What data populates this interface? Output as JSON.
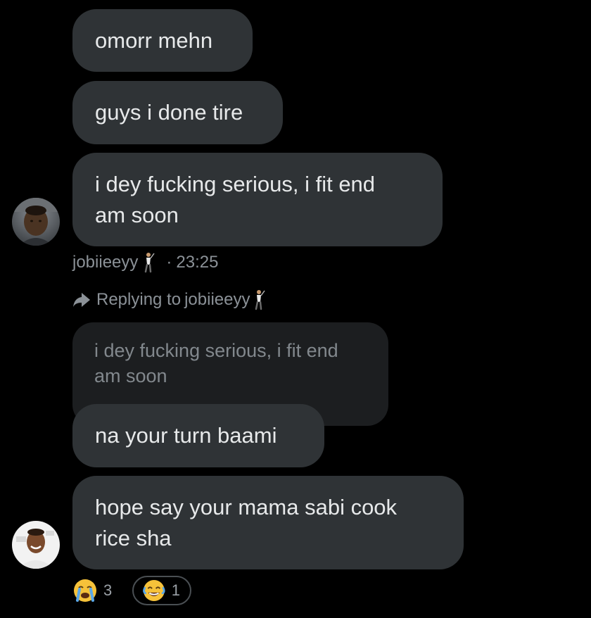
{
  "messages": [
    {
      "text": "omorr mehn"
    },
    {
      "text": "guys i done tire"
    },
    {
      "text": "i dey fucking serious, i fit end\nam soon"
    }
  ],
  "first_sender": {
    "username": "jobiieeyy",
    "timestamp": "23:25",
    "separator": "·",
    "emoji_icon": "golfer-icon"
  },
  "reply": {
    "prefix": "Replying to",
    "username": "jobiieeyy",
    "quoted_text": "i dey fucking serious, i fit end\nam soon",
    "message": "na your turn baami"
  },
  "last_message": {
    "text": "hope say your mama sabi cook\nrice sha"
  },
  "reactions": [
    {
      "emoji": "loudly-crying-face-icon",
      "count": "3"
    },
    {
      "emoji": "face-with-tears-of-joy-icon",
      "count": "1"
    }
  ],
  "colors": {
    "background": "#000000",
    "bubble": "#2f3336",
    "quoted_bubble": "#1c1e20",
    "text": "#e7e9ea",
    "muted": "#8b9197"
  }
}
